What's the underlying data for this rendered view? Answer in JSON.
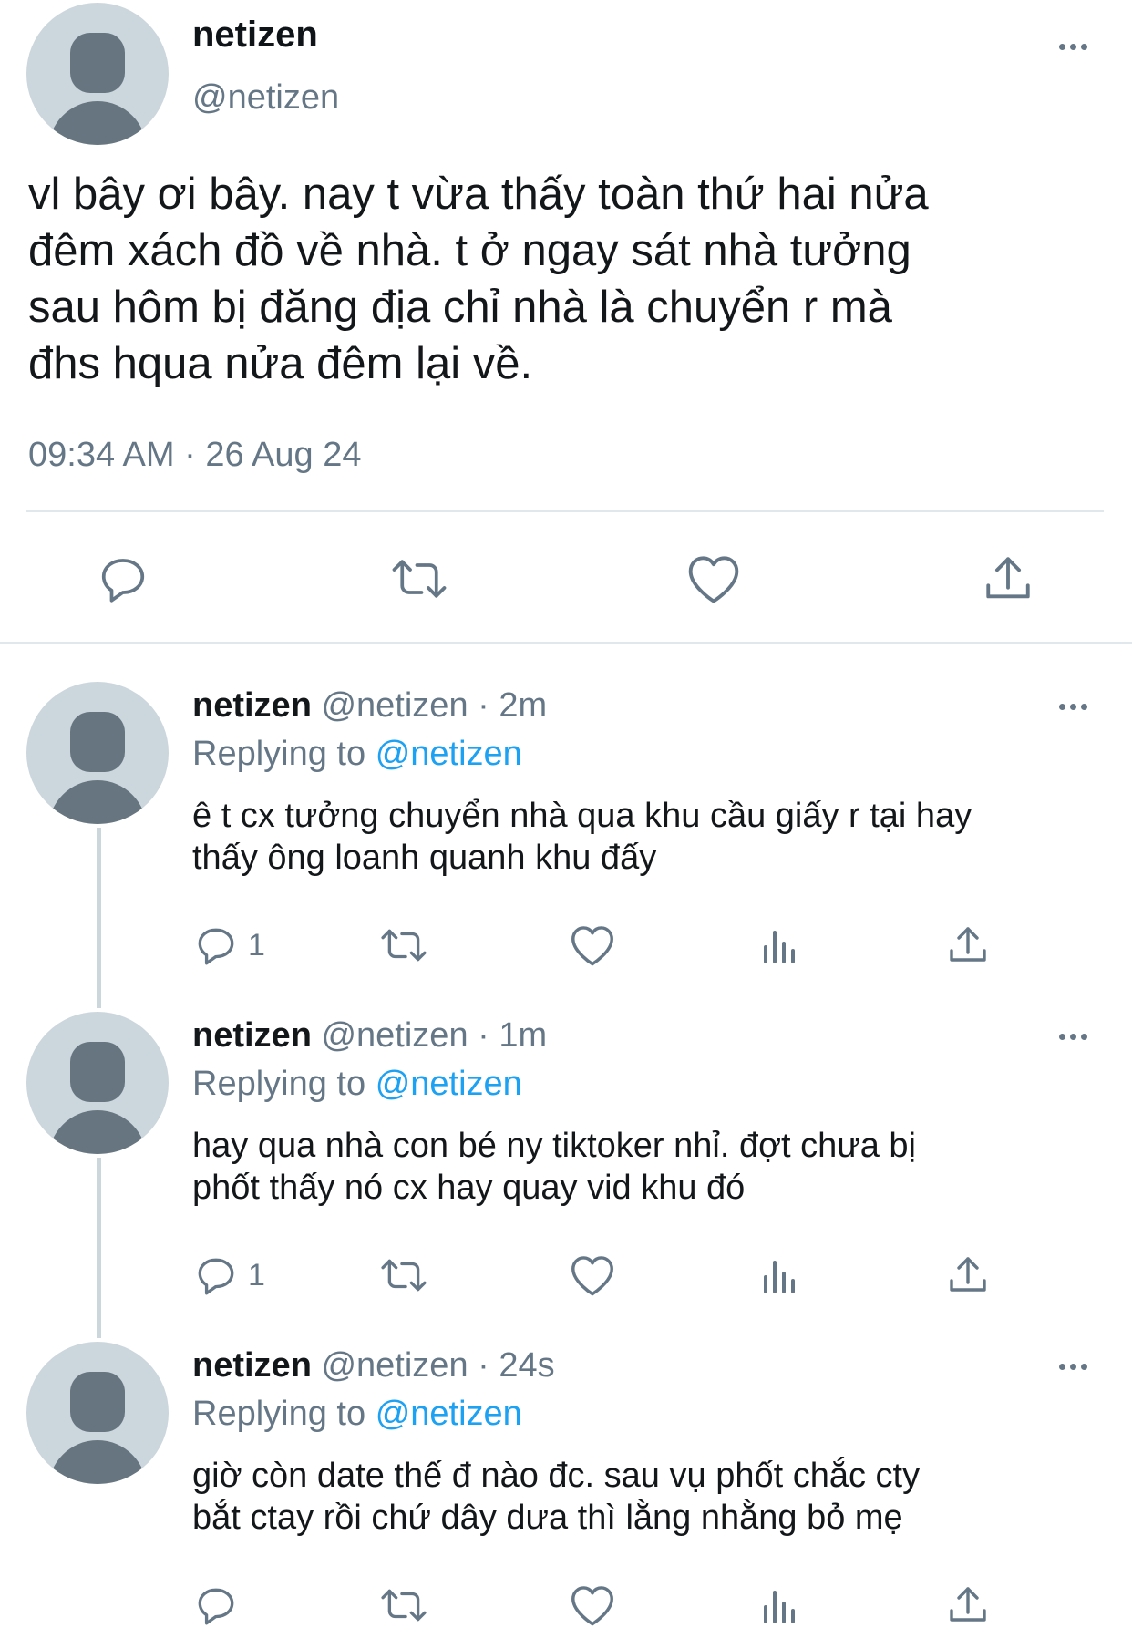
{
  "main_tweet": {
    "name": "netizen",
    "handle": "@netizen",
    "text": "vl bây ơi bây. nay t vừa thấy toàn thứ hai nửa\nđêm xách đồ về nhà. t ở ngay sát nhà tưởng\nsau hôm bị đăng địa chỉ nhà là chuyển r mà\nđhs hqua nửa đêm lại về.",
    "timestamp": "09:34 AM · 26 Aug 24",
    "actions": [
      "reply-icon",
      "retweet-icon",
      "like-icon",
      "share-icon"
    ]
  },
  "replies": [
    {
      "name": "netizen",
      "handle_time": "@netizen · 2m",
      "replying_label": "Replying to",
      "replying_to": "@netizen",
      "text": "ê t cx tưởng chuyển nhà qua khu cầu giấy r tại hay\nthấy ông loanh quanh khu đấy",
      "reply_count": "1"
    },
    {
      "name": "netizen",
      "handle_time": "@netizen · 1m",
      "replying_label": "Replying to",
      "replying_to": "@netizen",
      "text": "hay qua nhà con bé ny tiktoker nhỉ. đợt chưa bị\nphốt thấy nó cx hay quay vid khu đó",
      "reply_count": "1"
    },
    {
      "name": "netizen",
      "handle_time": "@netizen · 24s",
      "replying_label": "Replying to",
      "replying_to": "@netizen",
      "text": "giờ còn date thế đ nào đc. sau vụ phốt chắc cty\nbắt ctay rồi chứ dây dưa thì lằng nhằng bỏ mẹ",
      "reply_count": ""
    }
  ],
  "colors": {
    "text": "#14171a",
    "secondary": "#657786",
    "link": "#1da1f2",
    "divider": "#e1e8ed",
    "avatar_bg": "#ccd6dd"
  }
}
